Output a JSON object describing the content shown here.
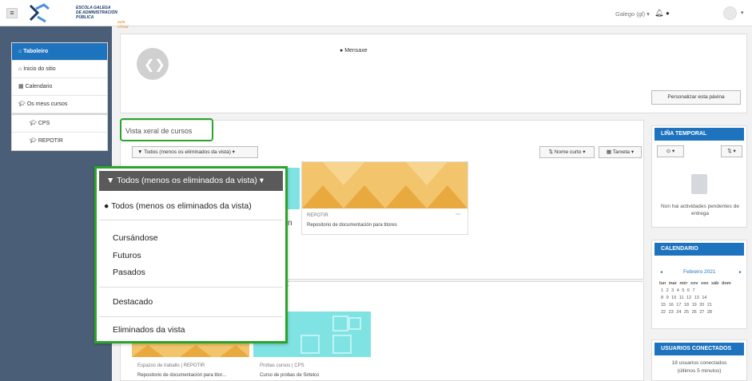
{
  "header": {
    "menu_icon": "hamburger-icon",
    "logo_lines": [
      "ESCOLA GALEGA",
      "DE ADMINISTRACIÓN",
      "PÚBLICA"
    ],
    "logo_subtitle": "aula virtual",
    "language": "Galego (gl) ▾",
    "notification_icon": "bell-icon",
    "messages_icon": "chat-icon",
    "user_menu_caret": "▾"
  },
  "nav": {
    "items": [
      {
        "label": "Taboleiro",
        "active": true,
        "icon": "dashboard-icon"
      },
      {
        "label": "Inicio do sitio",
        "icon": "home-icon"
      },
      {
        "label": "Calendario",
        "icon": "calendar-icon"
      },
      {
        "label": "Os meus cursos",
        "icon": "graduation-cap-icon"
      }
    ],
    "courses": [
      {
        "label": "CPS"
      },
      {
        "label": "REPOTIR"
      }
    ]
  },
  "profile": {
    "message_label": "Mensaxe",
    "customize_button": "Personalizar esta páxina"
  },
  "overview": {
    "title": "Vista xeral de cursos",
    "filter_button": "Todos (menos os eliminados da vista) ▾",
    "sort_button": "Nome curto ▾",
    "view_button": "Tarxeta ▾",
    "cropped_text_1": "n",
    "cropped_text_2": "x",
    "courses": [
      {
        "category": "REPOTIR",
        "name": "Repositorio de documentación para titores",
        "color": "#f2c46b",
        "menu": "⋯"
      },
      {
        "category": "Espazos de traballo | REPOTIR",
        "name": "Repositorio de documentación para titor...",
        "color": "#f2c46b"
      },
      {
        "category": "Probas cursos | CPS",
        "name": "Curso de probas de Sirtelco",
        "color": "#7fe3e3"
      }
    ]
  },
  "dropdown": {
    "header": "Todos (menos os eliminados da vista) ▾",
    "items": [
      "Todos (menos os eliminados da vista)",
      "Cursándose",
      "Futuros",
      "Pasados",
      "Destacado",
      "Eliminados da vista"
    ],
    "selected_index": 0
  },
  "timeline": {
    "title": "LIÑA TEMPORAL",
    "filter": "⊙ ▾",
    "sort": "⇅ ▾",
    "empty": "Non hai actividades pendentes de entrega"
  },
  "calendar": {
    "title": "CALENDARIO",
    "prev": "◄",
    "month": "Febreiro 2021",
    "next": "►",
    "weekdays": "lun mar mér xov ven sáb dom",
    "weeks": [
      "1 2 3 4 5 6 7",
      "8 9 10 11 12 13 14",
      "15 16 17 18 19 20 21",
      "22 23 24 25 26 27 28"
    ]
  },
  "online_users": {
    "title": "USUARIOS CONECTADOS",
    "text": "18 usuarios conectados",
    "subtext": "(últimos 5 minutos)"
  }
}
